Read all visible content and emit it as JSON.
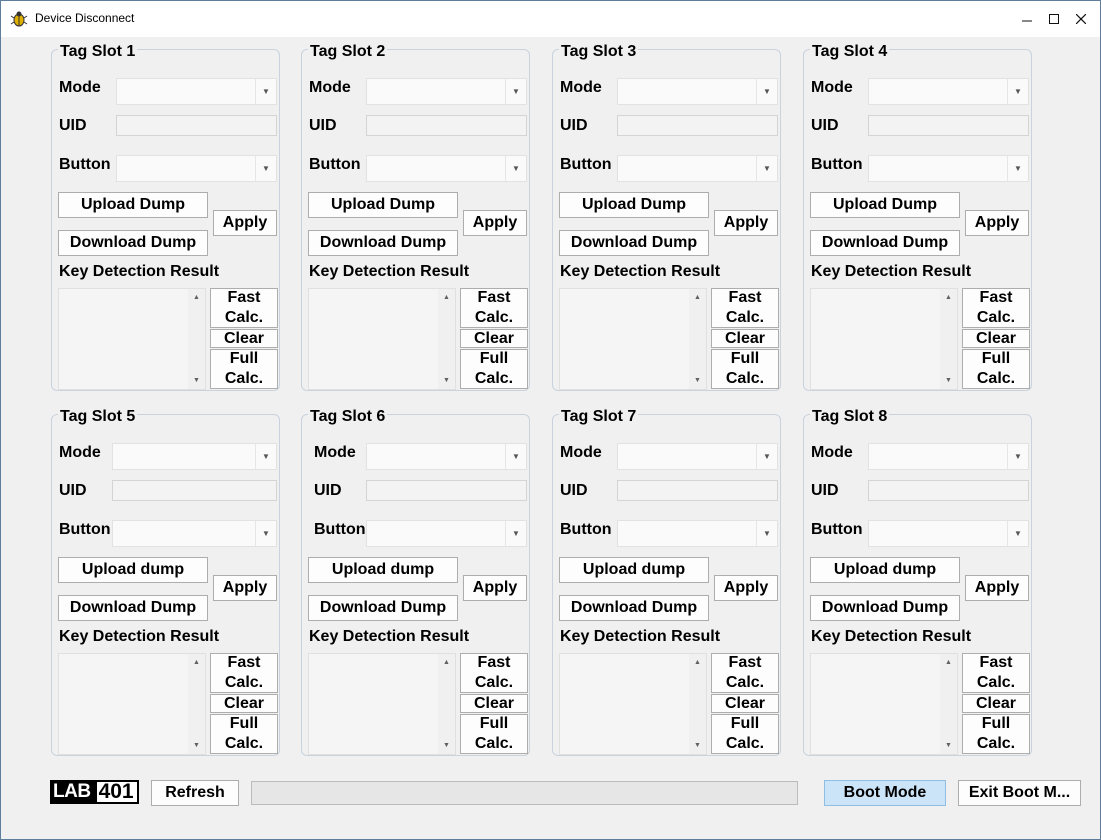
{
  "window": {
    "title": "Device Disconnect"
  },
  "slots": [
    {
      "title": "Tag Slot 1",
      "mode_label": "Mode",
      "uid_label": "UID",
      "button_label": "Button",
      "upload_label": "Upload Dump",
      "download_label": "Download Dump",
      "apply_label": "Apply",
      "key_label": "Key Detection Result",
      "fast_label": "Fast Calc.",
      "clear_label": "Clear",
      "full_label": "Full Calc."
    },
    {
      "title": "Tag Slot 2",
      "mode_label": "Mode",
      "uid_label": "UID",
      "button_label": "Button",
      "upload_label": "Upload Dump",
      "download_label": "Download Dump",
      "apply_label": "Apply",
      "key_label": "Key Detection Result",
      "fast_label": "Fast Calc.",
      "clear_label": "Clear",
      "full_label": "Full Calc."
    },
    {
      "title": "Tag Slot 3",
      "mode_label": "Mode",
      "uid_label": "UID",
      "button_label": "Button",
      "upload_label": "Upload Dump",
      "download_label": "Download Dump",
      "apply_label": "Apply",
      "key_label": "Key Detection Result",
      "fast_label": "Fast Calc.",
      "clear_label": "Clear",
      "full_label": "Full Calc."
    },
    {
      "title": "Tag Slot 4",
      "mode_label": "Mode",
      "uid_label": "UID",
      "button_label": "Button",
      "upload_label": "Upload Dump",
      "download_label": "Download Dump",
      "apply_label": "Apply",
      "key_label": "Key Detection Result",
      "fast_label": "Fast Calc.",
      "clear_label": "Clear",
      "full_label": "Full Calc."
    },
    {
      "title": "Tag Slot 5",
      "mode_label": "Mode",
      "uid_label": "UID",
      "button_label": "Button",
      "upload_label": "Upload dump",
      "download_label": "Download Dump",
      "apply_label": "Apply",
      "key_label": "Key Detection Result",
      "fast_label": "Fast Calc.",
      "clear_label": "Clear",
      "full_label": "Full Calc."
    },
    {
      "title": "Tag Slot 6",
      "mode_label": "Mode",
      "uid_label": "UID",
      "button_label": "Button",
      "upload_label": "Upload dump",
      "download_label": "Download Dump",
      "apply_label": "Apply",
      "key_label": "Key Detection Result",
      "fast_label": "Fast Calc.",
      "clear_label": "Clear",
      "full_label": "Full Calc."
    },
    {
      "title": "Tag Slot 7",
      "mode_label": "Mode",
      "uid_label": "UID",
      "button_label": "Button",
      "upload_label": "Upload dump",
      "download_label": "Download Dump",
      "apply_label": "Apply",
      "key_label": "Key Detection Result",
      "fast_label": "Fast Calc.",
      "clear_label": "Clear",
      "full_label": "Full Calc."
    },
    {
      "title": "Tag Slot 8",
      "mode_label": "Mode",
      "uid_label": "UID",
      "button_label": "Button",
      "upload_label": "Upload dump",
      "download_label": "Download Dump",
      "apply_label": "Apply",
      "key_label": "Key Detection Result",
      "fast_label": "Fast Calc.",
      "clear_label": "Clear",
      "full_label": "Full Calc."
    }
  ],
  "footer": {
    "logo_left": "LAB",
    "logo_right": "401",
    "refresh_label": "Refresh",
    "progress": 0,
    "boot_mode_label": "Boot Mode",
    "exit_boot_label": "Exit Boot M..."
  },
  "icons": {
    "app": "bug-icon",
    "minimize": "minimize-icon",
    "maximize": "maximize-icon",
    "close": "close-icon",
    "dropdown": "chevron-down-icon"
  }
}
